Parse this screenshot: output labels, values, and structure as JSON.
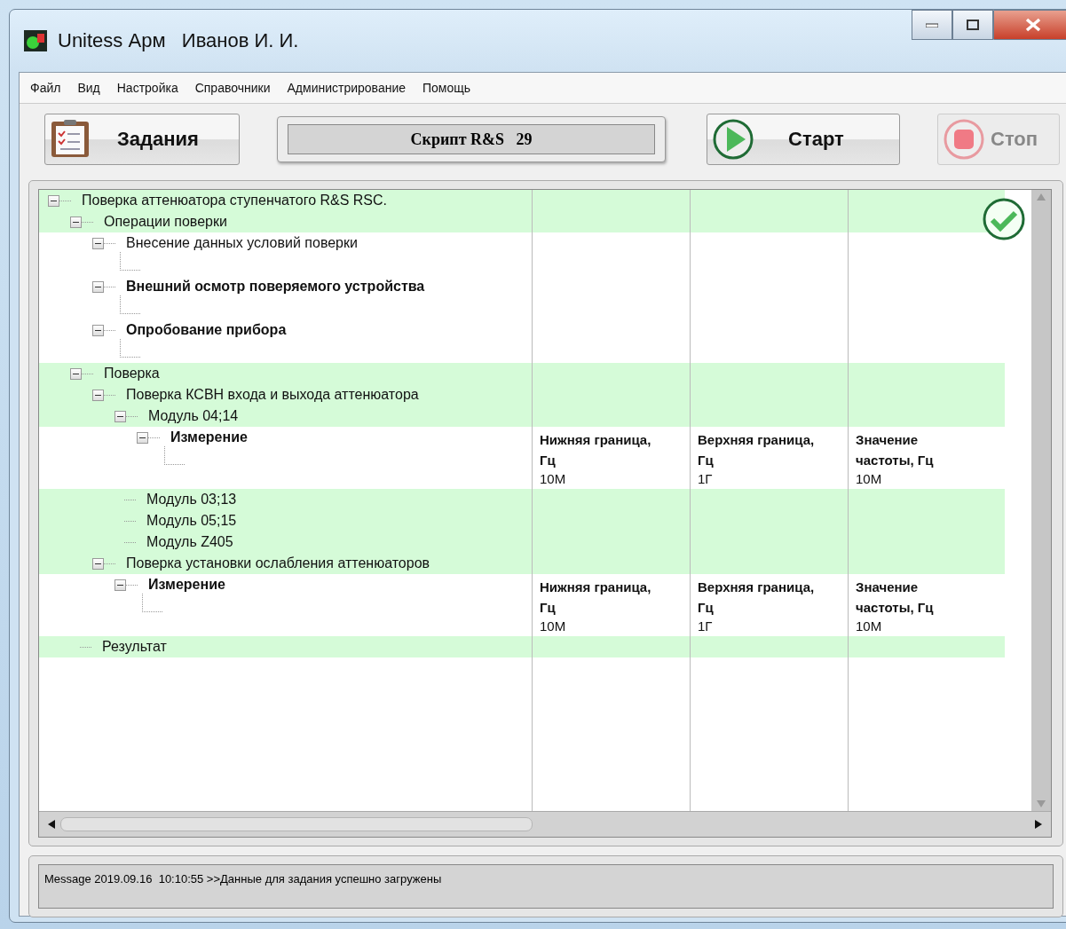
{
  "window": {
    "title": "Unitess Арм   Иванов И. И."
  },
  "menu": [
    "Файл",
    "Вид",
    "Настройка",
    "Справочники",
    "Администрирование",
    "Помощь"
  ],
  "toolbar": {
    "tasks_button": "Задания",
    "script_field": "Скрипт R&S   29",
    "start_button": {
      "label": "Старт",
      "disabled": false
    },
    "stop_button": {
      "label": "Стоп",
      "disabled": true
    }
  },
  "tree": {
    "completed": true,
    "nodes": [
      {
        "label": "Поверка аттенюатора ступенчатого R&S RSC.",
        "bold": false,
        "highlighted": true,
        "expanded": true,
        "children": [
          {
            "label": "Операции поверки",
            "bold": false,
            "highlighted": true,
            "expanded": true,
            "children": [
              {
                "label": "Внесение данных условий поверки",
                "bold": false,
                "highlighted": false,
                "expanded": true
              },
              {
                "label": "Внешний осмотр поверяемого устройства",
                "bold": true,
                "highlighted": false,
                "expanded": true
              },
              {
                "label": "Опробование прибора",
                "bold": true,
                "highlighted": false,
                "expanded": true
              }
            ]
          },
          {
            "label": "Поверка",
            "bold": false,
            "highlighted": true,
            "expanded": true,
            "children": [
              {
                "label": "Поверка КСВН входа и выхода аттенюатора",
                "bold": false,
                "highlighted": true,
                "expanded": true,
                "children": [
                  {
                    "label": "Модуль 04;14",
                    "bold": false,
                    "highlighted": true,
                    "expanded": true,
                    "children": [
                      {
                        "label": "Измерение",
                        "bold": true,
                        "highlighted": false,
                        "expanded": true,
                        "fields": [
                          {
                            "heading": "Нижняя граница, Гц",
                            "value": "10М"
                          },
                          {
                            "heading": "Верхняя граница, Гц",
                            "value": "1Г"
                          },
                          {
                            "heading": "Значение частоты, Гц",
                            "value": "10М"
                          }
                        ]
                      }
                    ]
                  },
                  {
                    "label": "Модуль 03;13",
                    "bold": false,
                    "highlighted": true
                  },
                  {
                    "label": "Модуль 05;15",
                    "bold": false,
                    "highlighted": true
                  },
                  {
                    "label": "Модуль Z405",
                    "bold": false,
                    "highlighted": true
                  }
                ]
              },
              {
                "label": "Поверка установки ослабления аттенюаторов",
                "bold": false,
                "highlighted": true,
                "expanded": true,
                "children": [
                  {
                    "label": "Измерение",
                    "bold": true,
                    "highlighted": false,
                    "expanded": true,
                    "fields": [
                      {
                        "heading": "Нижняя граница, Гц",
                        "value": "10М"
                      },
                      {
                        "heading": "Верхняя граница, Гц",
                        "value": "1Г"
                      },
                      {
                        "heading": "Значение частоты, Гц",
                        "value": "10М"
                      }
                    ]
                  }
                ]
              }
            ]
          },
          {
            "label": "Результат",
            "bold": false,
            "highlighted": true
          }
        ]
      }
    ]
  },
  "status_message": "Message 2019.09.16  10:10:55 >>Данные для задания успешно загружены"
}
